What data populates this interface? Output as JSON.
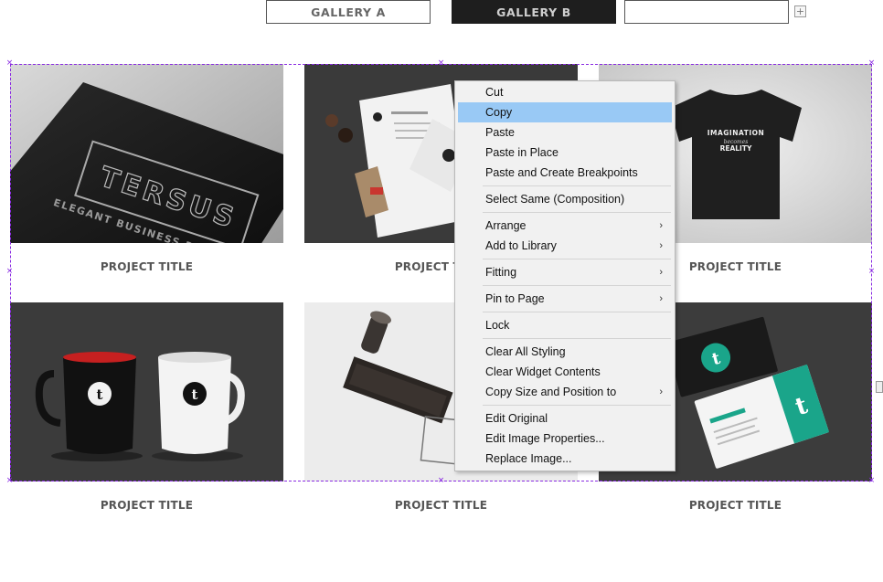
{
  "tabs": [
    {
      "label": "GALLERY A"
    },
    {
      "label": "GALLERY B"
    },
    {
      "label": ""
    }
  ],
  "add_tab_icon": "plus-icon",
  "gallery": {
    "items": [
      {
        "caption": "PROJECT TITLE",
        "image_text": "TERSUS",
        "image_subtext": "ELEGANT BUSINESS PORTFOLIO"
      },
      {
        "caption": "PROJECT TITLE"
      },
      {
        "caption": "PROJECT TITLE",
        "image_text": "IMAGINATION",
        "image_subtext": "becomes",
        "image_text2": "REALITY"
      },
      {
        "caption": "PROJECT TITLE"
      },
      {
        "caption": "PROJECT TITLE"
      },
      {
        "caption": "PROJECT TITLE"
      }
    ]
  },
  "context_menu": {
    "items": [
      {
        "label": "Cut"
      },
      {
        "label": "Copy",
        "highlighted": true
      },
      {
        "label": "Paste"
      },
      {
        "label": "Paste in Place"
      },
      {
        "label": "Paste and Create Breakpoints"
      },
      {
        "label": "Select Same (Composition)"
      },
      {
        "label": "Arrange",
        "submenu": true
      },
      {
        "label": "Add to Library",
        "submenu": true
      },
      {
        "label": "Fitting",
        "submenu": true
      },
      {
        "label": "Pin to Page",
        "submenu": true
      },
      {
        "label": "Lock"
      },
      {
        "label": "Clear All Styling"
      },
      {
        "label": "Clear Widget Contents"
      },
      {
        "label": "Copy Size and Position to",
        "submenu": true
      },
      {
        "label": "Edit Original"
      },
      {
        "label": "Edit Image Properties..."
      },
      {
        "label": "Replace Image..."
      }
    ],
    "submenu_glyph": "›"
  },
  "colors": {
    "selection": "#8a2be2",
    "menu_highlight": "#99c9f5",
    "active_tab": "#1e1e1e",
    "brand_teal": "#1aa58a"
  }
}
